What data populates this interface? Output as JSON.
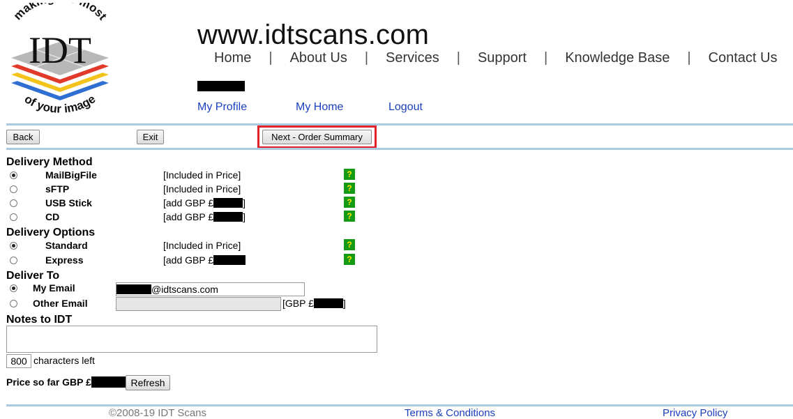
{
  "logo": {
    "top_text": "making the most",
    "brand": "IDT",
    "bottom_text": "of your image",
    "colors": {
      "red": "#e23a2a",
      "yellow": "#f2c31a",
      "blue": "#2f6fd1",
      "gray": "#b8b8b8"
    }
  },
  "header": {
    "site_title": "www.idtscans.com",
    "nav": [
      "Home",
      "About Us",
      "Services",
      "Support",
      "Knowledge Base",
      "Contact Us"
    ],
    "nav_separator": "|",
    "sub_links": {
      "profile": "My Profile",
      "my_home": "My Home",
      "logout": "Logout"
    }
  },
  "toolbar": {
    "back_label": "Back",
    "exit_label": "Exit",
    "next_label": "Next - Order Summary",
    "highlight_color": "#e0222a"
  },
  "delivery_method": {
    "title": "Delivery Method",
    "options": [
      {
        "label": "MailBigFile",
        "price": "[Included in Price]",
        "selected": true
      },
      {
        "label": "sFTP",
        "price": "[Included in Price]",
        "selected": false
      },
      {
        "label": "USB Stick",
        "price_prefix": "[add GBP £",
        "price_suffix": "]",
        "selected": false
      },
      {
        "label": "CD",
        "price_prefix": "[add GBP £",
        "price_suffix": "]",
        "selected": false
      }
    ],
    "help_glyph": "?"
  },
  "delivery_options": {
    "title": "Delivery Options",
    "options": [
      {
        "label": "Standard",
        "price": "[Included in Price]",
        "selected": true
      },
      {
        "label": "Express",
        "price_prefix": "[add GBP £",
        "selected": false
      }
    ]
  },
  "deliver_to": {
    "title": "Deliver To",
    "my_email_label": "My Email",
    "my_email_value_suffix": "@idtscans.com",
    "other_email_label": "Other Email",
    "other_price_prefix": "[GBP £",
    "other_price_suffix": "]",
    "my_email_selected": true
  },
  "notes": {
    "title": "Notes to IDT",
    "chars_left_value": "800",
    "chars_left_label": "characters left"
  },
  "price": {
    "label": "Price so far GBP £",
    "refresh_label": "Refresh"
  },
  "footer": {
    "copyright": "©2008-19 IDT Scans",
    "terms": "Terms & Conditions",
    "privacy": "Privacy Policy"
  }
}
